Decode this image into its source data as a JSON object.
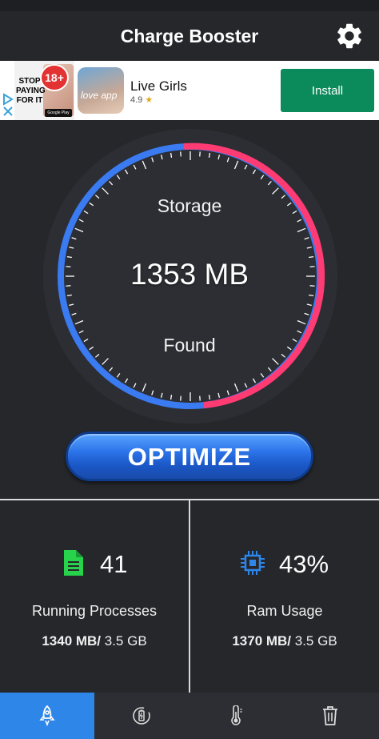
{
  "app": {
    "title": "Charge Booster"
  },
  "ad": {
    "thumb_text": "STOP PAYING FOR IT",
    "badge": "18+",
    "store_badge": "Google Play",
    "thumb2_text": "love app",
    "name": "Live Girls",
    "rating": "4.9",
    "install_label": "Install"
  },
  "gauge": {
    "label_top": "Storage",
    "value": "1353 MB",
    "label_bottom": "Found"
  },
  "optimize_label": "OPTIMIZE",
  "stats": {
    "processes": {
      "value": "41",
      "label": "Running Processes",
      "mem_used": "1340 MB/",
      "mem_total": " 3.5 GB"
    },
    "ram": {
      "value": "43%",
      "label": "Ram Usage",
      "mem_used": "1370 MB/",
      "mem_total": " 3.5 GB"
    }
  },
  "colors": {
    "accent_blue": "#2f86e9",
    "dial_blue": "#3a7bf2",
    "dial_pink": "#ff3b73",
    "install_green": "#0b8a5b",
    "doc_green": "#27d34a"
  },
  "nav": {
    "items": [
      {
        "icon": "rocket-icon",
        "active": true
      },
      {
        "icon": "battery-refresh-icon",
        "active": false
      },
      {
        "icon": "thermometer-icon",
        "active": false
      },
      {
        "icon": "trash-icon",
        "active": false
      }
    ]
  }
}
